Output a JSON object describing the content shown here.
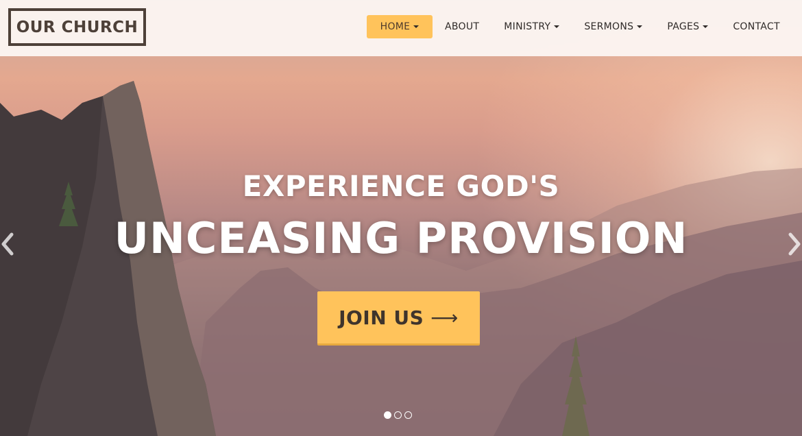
{
  "brand": {
    "logo_text": "OUR CHURCH"
  },
  "nav": {
    "items": [
      {
        "label": "HOME",
        "has_caret": true,
        "active": true
      },
      {
        "label": "ABOUT",
        "has_caret": false
      },
      {
        "label": "MINISTRY",
        "has_caret": true
      },
      {
        "label": "SERMONS",
        "has_caret": true
      },
      {
        "label": "PAGES",
        "has_caret": true
      },
      {
        "label": "CONTACT",
        "has_caret": false
      }
    ]
  },
  "hero": {
    "line1": "EXPERIENCE GOD'S",
    "line2": "UNCEASING PROVISION",
    "cta_label": "JOIN US",
    "cta_arrow": "⟶",
    "prev_icon": "chevron-left-icon",
    "next_icon": "chevron-right-icon"
  },
  "carousel": {
    "slide_count": 3,
    "active_index": 0
  },
  "colors": {
    "accent": "#ffc35b",
    "logo": "#4d4038",
    "nav_text": "#2f2a28",
    "hero_text": "#ffffff"
  }
}
